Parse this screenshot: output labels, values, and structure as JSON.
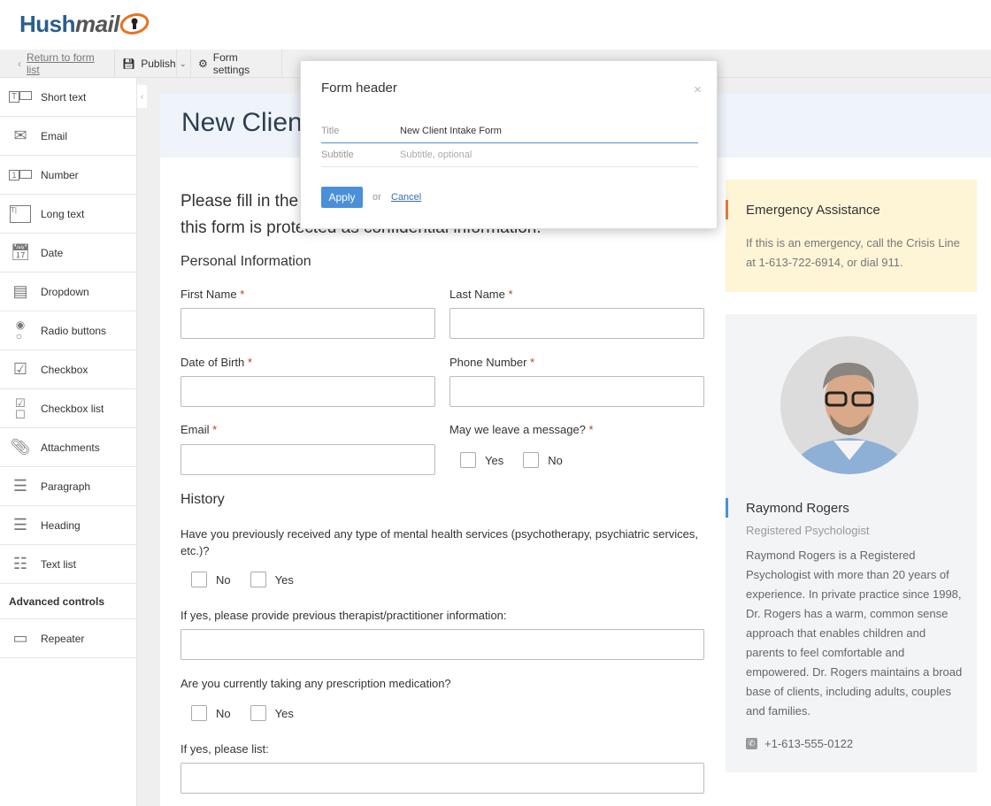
{
  "brand": {
    "logo_part1": "Hush",
    "logo_part2": "mail"
  },
  "toolbar": {
    "return": "Return to form list",
    "publish": "Publish",
    "settings": "Form settings"
  },
  "sidebar": {
    "items": [
      {
        "label": "Short text",
        "icon": "short-text"
      },
      {
        "label": "Email",
        "icon": "envelope"
      },
      {
        "label": "Number",
        "icon": "number"
      },
      {
        "label": "Long text",
        "icon": "long-text"
      },
      {
        "label": "Date",
        "icon": "calendar"
      },
      {
        "label": "Dropdown",
        "icon": "dropdown"
      },
      {
        "label": "Radio buttons",
        "icon": "radio"
      },
      {
        "label": "Checkbox",
        "icon": "checkbox"
      },
      {
        "label": "Checkbox list",
        "icon": "checkbox-list"
      },
      {
        "label": "Attachments",
        "icon": "paperclip"
      },
      {
        "label": "Paragraph",
        "icon": "paragraph"
      },
      {
        "label": "Heading",
        "icon": "heading"
      },
      {
        "label": "Text list",
        "icon": "text-list"
      }
    ],
    "advanced_heading": "Advanced controls",
    "advanced_items": [
      {
        "label": "Repeater",
        "icon": "repeater"
      }
    ]
  },
  "form": {
    "title": "New Client Intake Form",
    "intro_line1": "Please fill in the",
    "intro_line2": "this form is protected as confidential information.",
    "personal_heading": "Personal Information",
    "first_name": "First Name",
    "last_name": "Last Name",
    "dob": "Date of Birth",
    "phone": "Phone Number",
    "email": "Email",
    "message": "May we leave a message?",
    "req": "*",
    "yes": "Yes",
    "no": "No",
    "history_heading": "History",
    "q1": "Have you previously received any type of mental health services (psychotherapy, psychiatric services, etc.)?",
    "q2": "If yes, please provide previous therapist/practitioner information:",
    "q3": "Are you currently taking any prescription medication?",
    "q4": "If yes, please list:"
  },
  "emergency": {
    "title": "Emergency Assistance",
    "text": "If this is an emergency, call the Crisis Line at 1-613-722-6914, or dial 911.",
    "accent": "#e07b39",
    "bg": "#fdf5d6"
  },
  "profile": {
    "name": "Raymond Rogers",
    "role": "Registered Psychologist",
    "bio": "Raymond Rogers is a Registered Psychologist with more than 20 years of experience. In private practice since 1998, Dr. Rogers has a warm, common sense approach that enables children and parents to feel comfortable and empowered. Dr. Rogers maintains a broad base of clients, including adults, couples and families.",
    "phone": "+1-613-555-0122",
    "accent": "#4a90d9"
  },
  "modal": {
    "title": "Form header",
    "title_label": "Title",
    "title_value": "New Client Intake Form",
    "subtitle_label": "Subtitle",
    "subtitle_placeholder": "Subtitle, optional",
    "apply": "Apply",
    "or": "or",
    "cancel": "Cancel",
    "accent": "#4a90d9"
  }
}
